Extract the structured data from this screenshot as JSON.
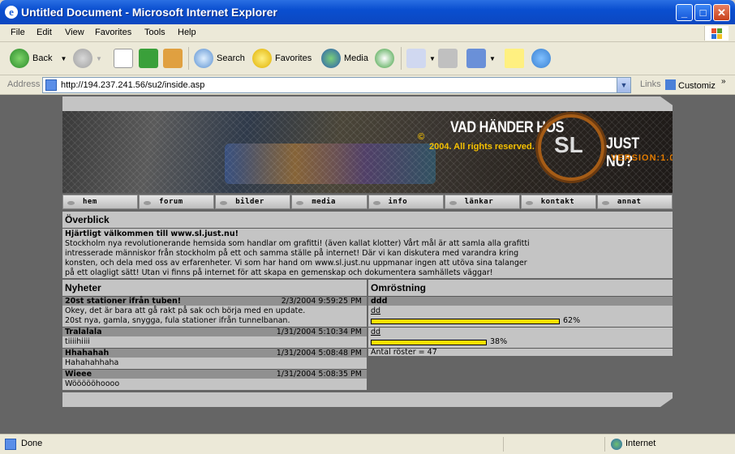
{
  "window": {
    "title": "Untitled Document - Microsoft Internet Explorer"
  },
  "menu": [
    "File",
    "Edit",
    "View",
    "Favorites",
    "Tools",
    "Help"
  ],
  "toolbar": {
    "back": "Back",
    "search": "Search",
    "favorites": "Favorites",
    "media": "Media"
  },
  "address": {
    "label": "Address",
    "url": "http://194.237.241.56/su2/inside.asp",
    "links": "Links",
    "customize": "Customiz"
  },
  "banner": {
    "title": "VAD HÄNDER HOS",
    "copyright": "©",
    "rights": "2004. All rights reserved.",
    "logo": "SL",
    "just": "JUST NU?",
    "version": "VERSION:1.0"
  },
  "nav": [
    "hem",
    "forum",
    "bilder",
    "media",
    "info",
    "länkar",
    "kontakt",
    "annat"
  ],
  "overview": {
    "heading": "Överblick",
    "welcome": "Hjärtligt välkommen till www.sl.just.nu!",
    "lines": [
      "Stockholm nya revolutionerande hemsida som handlar om grafitti! (även kallat klotter) Vårt mål är att samla alla grafitti",
      "intresserade människor från stockholm på ett och samma ställe på internet! Där vi kan diskutera med varandra kring",
      "konsten, och dela med oss av erfarenheter. Vi som har hand om www.sl.just.nu uppmanar ingen att utöva sina talanger",
      "på ett olagligt sätt! Utan vi finns på internet för att skapa en gemenskap och dokumentera samhällets väggar!"
    ]
  },
  "news": {
    "heading": "Nyheter",
    "items": [
      {
        "title": "20st stationer ifrån tuben!",
        "date": "2/3/2004 9:59:25 PM",
        "body": [
          "Okey, det är bara att gå rakt på sak och börja med en update.",
          "20st nya, gamla, snygga, fula stationer ifrån tunnelbanan."
        ]
      },
      {
        "title": "Tralalala",
        "date": "1/31/2004 5:10:34 PM",
        "body": [
          "tiiiihiiii"
        ]
      },
      {
        "title": "Hhahahah",
        "date": "1/31/2004 5:08:48 PM",
        "body": [
          "Hahahahhaha"
        ]
      },
      {
        "title": "Wieee",
        "date": "1/31/2004 5:08:35 PM",
        "body": [
          "Wöööööhoooo"
        ]
      }
    ]
  },
  "poll": {
    "heading": "Omröstning",
    "question": "ddd",
    "options": [
      {
        "label": "dd",
        "percent": "62%",
        "value": 0.62
      },
      {
        "label": "dd",
        "percent": "38%",
        "value": 0.38
      }
    ],
    "votes": "Antal röster = 47"
  },
  "status": {
    "text": "Done",
    "zone": "Internet"
  }
}
